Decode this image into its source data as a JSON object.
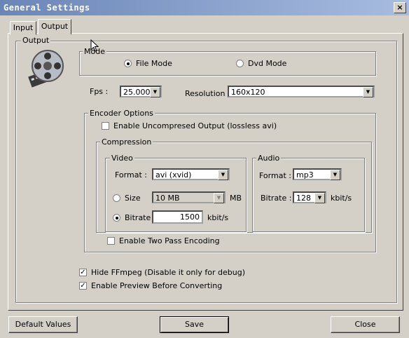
{
  "window": {
    "title": "General Settings",
    "close_glyph": "×"
  },
  "tabs": {
    "input": "Input",
    "output": "Output"
  },
  "output_group": {
    "title": "Output"
  },
  "mode": {
    "title": "Mode",
    "file_mode": "File Mode",
    "dvd_mode": "Dvd Mode",
    "selected": "File Mode"
  },
  "fps": {
    "label": "Fps :",
    "value": "25.000"
  },
  "resolution": {
    "label": "Resolution :",
    "value": "160x120"
  },
  "encoder": {
    "title": "Encoder Options",
    "uncompressed_label": "Enable Uncompresed Output (lossless avi)",
    "uncompressed_checked": false,
    "compression_title": "Compression",
    "two_pass_label": "Enable Two Pass Encoding",
    "two_pass_checked": false
  },
  "video": {
    "title": "Video",
    "format_label": "Format :",
    "format_value": "avi (xvid)",
    "size_label": "Size",
    "size_value": "10 MB",
    "size_unit": "MB",
    "bitrate_label": "Bitrate",
    "bitrate_value": "1500",
    "bitrate_unit": "kbit/s",
    "selected": "Bitrate"
  },
  "audio": {
    "title": "Audio",
    "format_label": "Format :",
    "format_value": "mp3",
    "bitrate_label": "Bitrate :",
    "bitrate_value": "128",
    "bitrate_unit": "kbit/s"
  },
  "options": {
    "hide_ffmpeg": "Hide FFmpeg (Disable it only for debug)",
    "hide_ffmpeg_checked": true,
    "preview": "Enable Preview Before Converting",
    "preview_checked": true
  },
  "buttons": {
    "default": "Default Values",
    "save": "Save",
    "close": "Close"
  },
  "icons": {
    "check": "✓",
    "dropdown": "▼",
    "output_icon": "film-reel-icon"
  }
}
